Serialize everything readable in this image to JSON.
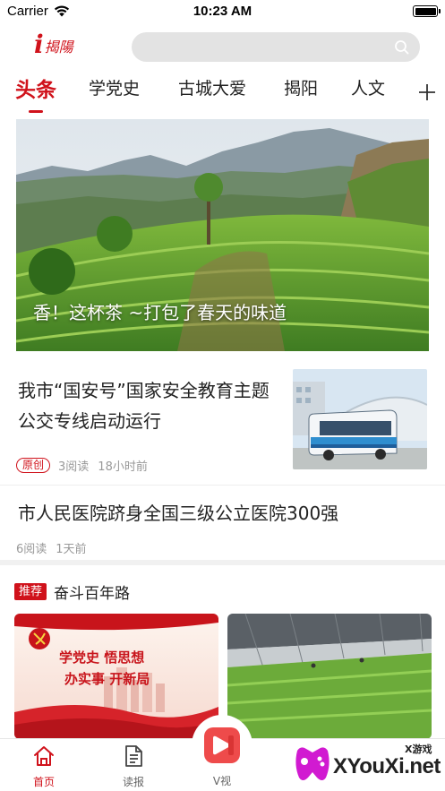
{
  "status_bar": {
    "carrier": "Carrier",
    "time": "10:23 AM"
  },
  "header": {
    "logo_mark": "i",
    "logo_text": "揭陽",
    "search_placeholder": ""
  },
  "tabs": [
    {
      "label": "头条",
      "active": true
    },
    {
      "label": "学党史",
      "active": false
    },
    {
      "label": "古城大爱",
      "active": false
    },
    {
      "label": "揭阳",
      "active": false
    },
    {
      "label": "人文",
      "active": false
    }
  ],
  "hero": {
    "caption": "香！这杯茶 ~打包了春天的味道"
  },
  "news": [
    {
      "title": "我市“国安号”国家安全教育主题公交专线启动运行",
      "badge": "原创",
      "reads": "3阅读",
      "time": "18小时前"
    },
    {
      "title": "市人民医院跻身全国三级公立医院300强",
      "reads": "6阅读",
      "time": "1天前"
    }
  ],
  "recommend": {
    "tag": "推荐",
    "title": "奋斗百年路",
    "card1": {
      "line1": "学党史 悟思想",
      "line2": "办实事 开新局"
    }
  },
  "bottom_nav": {
    "home": "首页",
    "reader": "读报",
    "video": "V视"
  },
  "watermark": {
    "main": "XYouXi.net",
    "small": "X游戏"
  },
  "colors": {
    "brand_red": "#d0121b",
    "video_button": "#ee4b4b",
    "search_bg": "#e3e3e3"
  }
}
